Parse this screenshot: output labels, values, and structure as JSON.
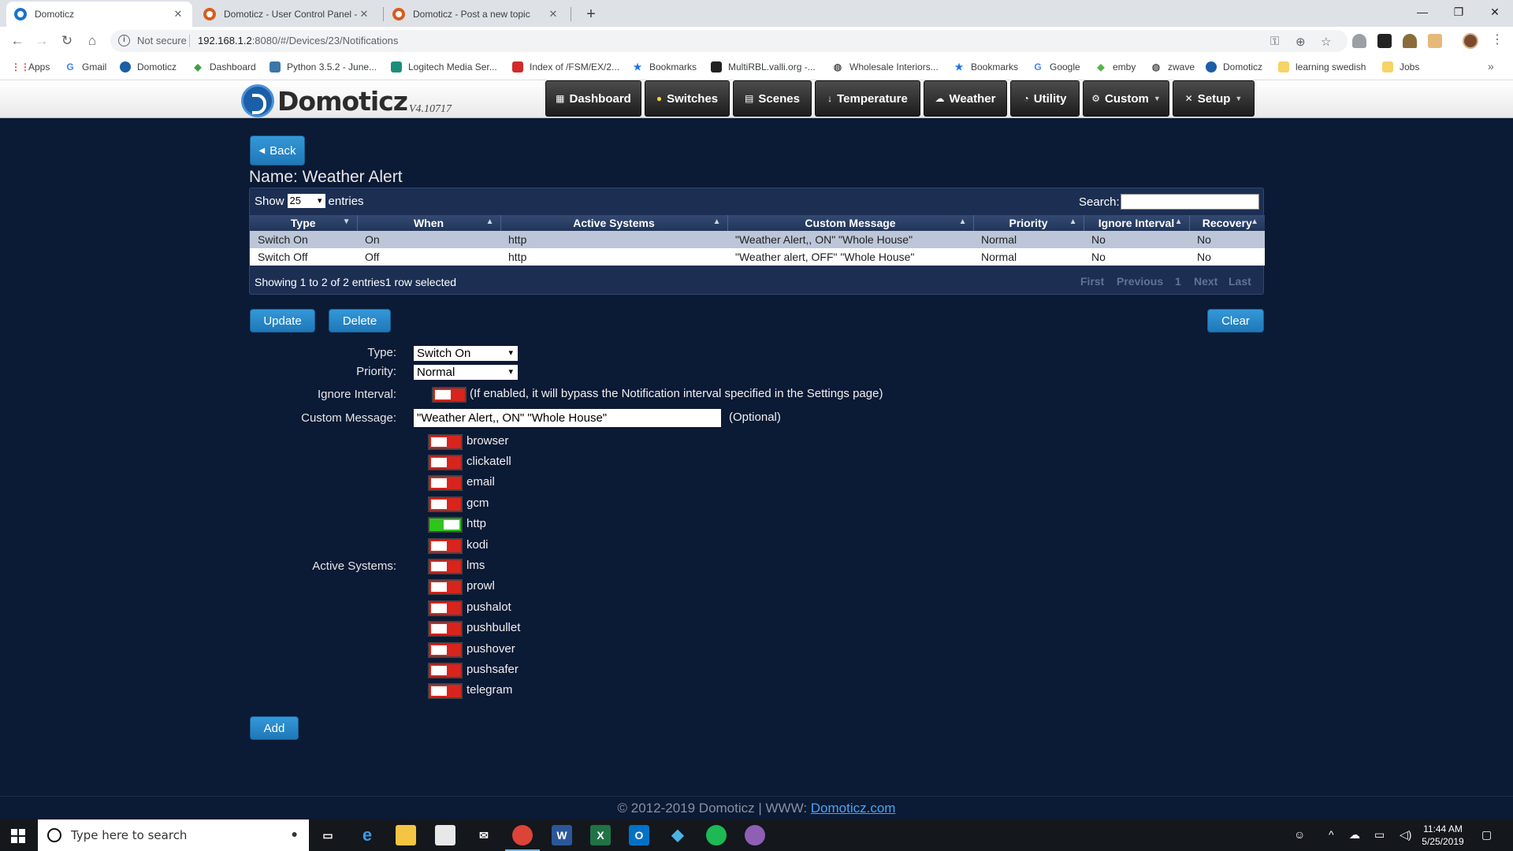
{
  "browser": {
    "tabs": [
      {
        "title": "Domoticz",
        "active": true
      },
      {
        "title": "Domoticz - User Control Panel - ",
        "active": false
      },
      {
        "title": "Domoticz - Post a new topic",
        "active": false
      }
    ],
    "security_label": "Not secure",
    "url_host": "192.168.1.2",
    "url_rest": ":8080/#/Devices/23/Notifications",
    "bookmarks": [
      {
        "label": "Apps",
        "icon": "apps-grid-icon",
        "color": "#e8453c"
      },
      {
        "label": "Gmail",
        "icon": "google-g-icon",
        "color": "#4285f4"
      },
      {
        "label": "Domoticz",
        "icon": "domoticz-icon",
        "color": "#1b5fa8"
      },
      {
        "label": "Dashboard",
        "icon": "diamond-icon",
        "color": "#3ea043"
      },
      {
        "label": "Python 3.5.2 - June...",
        "icon": "python-icon",
        "color": "#3b77a8"
      },
      {
        "label": "Logitech Media Ser...",
        "icon": "logitech-icon",
        "color": "#1c8f7a"
      },
      {
        "label": "Index of /FSM/EX/2...",
        "icon": "flag-icon",
        "color": "#d12a2a"
      },
      {
        "label": "Bookmarks",
        "icon": "star-icon",
        "color": "#1a73e8"
      },
      {
        "label": "MultiRBL.valli.org -...",
        "icon": "doc-icon",
        "color": "#222222"
      },
      {
        "label": "Wholesale Interiors...",
        "icon": "globe-icon",
        "color": "#555555"
      },
      {
        "label": "Bookmarks",
        "icon": "star-icon",
        "color": "#1a73e8"
      },
      {
        "label": "Google",
        "icon": "google-g-icon",
        "color": "#4285f4"
      },
      {
        "label": "emby",
        "icon": "emby-icon",
        "color": "#52b54b"
      },
      {
        "label": "zwave",
        "icon": "globe-icon",
        "color": "#555555"
      },
      {
        "label": "Domoticz",
        "icon": "domoticz-icon",
        "color": "#1b5fa8"
      },
      {
        "label": "learning swedish",
        "icon": "folder-icon",
        "color": "#f6d365"
      },
      {
        "label": "Jobs",
        "icon": "folder-icon",
        "color": "#f6d365"
      }
    ]
  },
  "app": {
    "logo_text": "Domoticz",
    "version": "V4.10717",
    "nav": [
      {
        "label": "Dashboard",
        "icon": "dashboard-icon",
        "dropdown": false
      },
      {
        "label": "Switches",
        "icon": "bulb-icon",
        "dropdown": false
      },
      {
        "label": "Scenes",
        "icon": "scenes-icon",
        "dropdown": false
      },
      {
        "label": "Temperature",
        "icon": "thermometer-icon",
        "dropdown": false
      },
      {
        "label": "Weather",
        "icon": "cloud-icon",
        "dropdown": false
      },
      {
        "label": "Utility",
        "icon": "gauge-icon",
        "dropdown": false
      },
      {
        "label": "Custom",
        "icon": "gear-icon",
        "dropdown": true
      },
      {
        "label": "Setup",
        "icon": "tools-icon",
        "dropdown": true
      }
    ]
  },
  "page": {
    "back_label": "Back",
    "name_label": "Name: Weather Alert",
    "table": {
      "show_label": "Show",
      "page_size": "25",
      "entries_label": "entries",
      "search_label": "Search:",
      "columns": [
        "Type",
        "When",
        "Active Systems",
        "Custom Message",
        "Priority",
        "Ignore Interval",
        "Recovery"
      ],
      "rows": [
        {
          "cells": [
            "Switch On",
            "On",
            "http",
            "\"Weather Alert,, ON\" \"Whole House\"",
            "Normal",
            "No",
            "No"
          ],
          "selected": true
        },
        {
          "cells": [
            "Switch Off",
            "Off",
            "http",
            "\"Weather alert, OFF\" \"Whole House\"",
            "Normal",
            "No",
            "No"
          ],
          "selected": false
        }
      ],
      "info": "Showing 1 to 2 of 2 entries1 row selected",
      "pagination": {
        "first": "First",
        "previous": "Previous",
        "current": "1",
        "next": "Next",
        "last": "Last"
      }
    },
    "buttons": {
      "update": "Update",
      "delete": "Delete",
      "clear": "Clear",
      "add": "Add"
    },
    "form": {
      "type_label": "Type:",
      "type_value": "Switch On",
      "priority_label": "Priority:",
      "priority_value": "Normal",
      "ignore_label": "Ignore Interval:",
      "ignore_enabled": false,
      "ignore_hint": "(If enabled, it will bypass the Notification interval specified in the Settings page)",
      "message_label": "Custom Message:",
      "message_value": "\"Weather Alert,, ON\" \"Whole House\"",
      "message_optional": "(Optional)",
      "systems_label": "Active Systems:",
      "systems": [
        {
          "name": "browser",
          "enabled": false
        },
        {
          "name": "clickatell",
          "enabled": false
        },
        {
          "name": "email",
          "enabled": false
        },
        {
          "name": "gcm",
          "enabled": false
        },
        {
          "name": "http",
          "enabled": true
        },
        {
          "name": "kodi",
          "enabled": false
        },
        {
          "name": "lms",
          "enabled": false
        },
        {
          "name": "prowl",
          "enabled": false
        },
        {
          "name": "pushalot",
          "enabled": false
        },
        {
          "name": "pushbullet",
          "enabled": false
        },
        {
          "name": "pushover",
          "enabled": false
        },
        {
          "name": "pushsafer",
          "enabled": false
        },
        {
          "name": "telegram",
          "enabled": false
        }
      ]
    },
    "footer": {
      "text": "© 2012-2019 Domoticz | WWW: ",
      "link": "Domoticz.com"
    }
  },
  "taskbar": {
    "search_placeholder": "Type here to search",
    "apps": [
      "task-view-icon",
      "edge-icon",
      "file-explorer-icon",
      "store-icon",
      "mail-icon",
      "chrome-icon",
      "word-icon",
      "excel-icon",
      "outlook-icon",
      "kodi-icon",
      "spotify-icon",
      "app-icon"
    ],
    "time": "11:44 AM",
    "date": "5/25/2019"
  },
  "colors": {
    "background": "#0b1a35",
    "accent": "#2a8bd0",
    "toggle_off": "#d8241d",
    "toggle_on": "#2fc51b"
  }
}
